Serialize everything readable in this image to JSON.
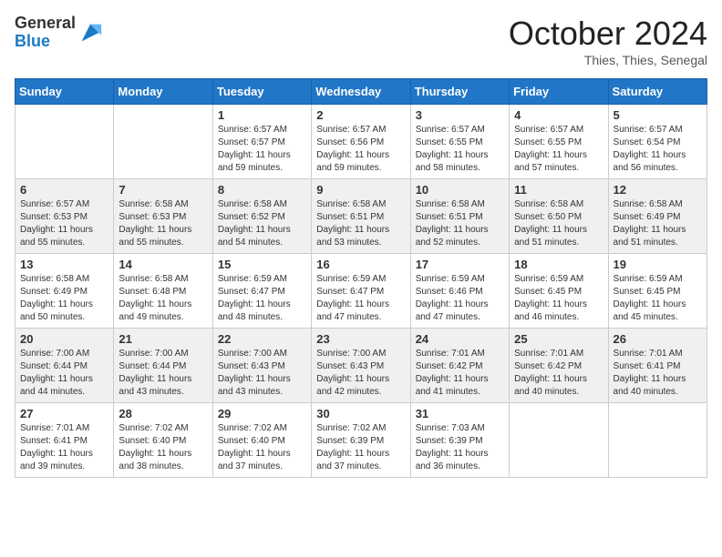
{
  "header": {
    "logo_general": "General",
    "logo_blue": "Blue",
    "month_title": "October 2024",
    "location": "Thies, Thies, Senegal"
  },
  "days_of_week": [
    "Sunday",
    "Monday",
    "Tuesday",
    "Wednesday",
    "Thursday",
    "Friday",
    "Saturday"
  ],
  "weeks": [
    [
      {
        "day": "",
        "sunrise": "",
        "sunset": "",
        "daylight": ""
      },
      {
        "day": "",
        "sunrise": "",
        "sunset": "",
        "daylight": ""
      },
      {
        "day": "1",
        "sunrise": "Sunrise: 6:57 AM",
        "sunset": "Sunset: 6:57 PM",
        "daylight": "Daylight: 11 hours and 59 minutes."
      },
      {
        "day": "2",
        "sunrise": "Sunrise: 6:57 AM",
        "sunset": "Sunset: 6:56 PM",
        "daylight": "Daylight: 11 hours and 59 minutes."
      },
      {
        "day": "3",
        "sunrise": "Sunrise: 6:57 AM",
        "sunset": "Sunset: 6:55 PM",
        "daylight": "Daylight: 11 hours and 58 minutes."
      },
      {
        "day": "4",
        "sunrise": "Sunrise: 6:57 AM",
        "sunset": "Sunset: 6:55 PM",
        "daylight": "Daylight: 11 hours and 57 minutes."
      },
      {
        "day": "5",
        "sunrise": "Sunrise: 6:57 AM",
        "sunset": "Sunset: 6:54 PM",
        "daylight": "Daylight: 11 hours and 56 minutes."
      }
    ],
    [
      {
        "day": "6",
        "sunrise": "Sunrise: 6:57 AM",
        "sunset": "Sunset: 6:53 PM",
        "daylight": "Daylight: 11 hours and 55 minutes."
      },
      {
        "day": "7",
        "sunrise": "Sunrise: 6:58 AM",
        "sunset": "Sunset: 6:53 PM",
        "daylight": "Daylight: 11 hours and 55 minutes."
      },
      {
        "day": "8",
        "sunrise": "Sunrise: 6:58 AM",
        "sunset": "Sunset: 6:52 PM",
        "daylight": "Daylight: 11 hours and 54 minutes."
      },
      {
        "day": "9",
        "sunrise": "Sunrise: 6:58 AM",
        "sunset": "Sunset: 6:51 PM",
        "daylight": "Daylight: 11 hours and 53 minutes."
      },
      {
        "day": "10",
        "sunrise": "Sunrise: 6:58 AM",
        "sunset": "Sunset: 6:51 PM",
        "daylight": "Daylight: 11 hours and 52 minutes."
      },
      {
        "day": "11",
        "sunrise": "Sunrise: 6:58 AM",
        "sunset": "Sunset: 6:50 PM",
        "daylight": "Daylight: 11 hours and 51 minutes."
      },
      {
        "day": "12",
        "sunrise": "Sunrise: 6:58 AM",
        "sunset": "Sunset: 6:49 PM",
        "daylight": "Daylight: 11 hours and 51 minutes."
      }
    ],
    [
      {
        "day": "13",
        "sunrise": "Sunrise: 6:58 AM",
        "sunset": "Sunset: 6:49 PM",
        "daylight": "Daylight: 11 hours and 50 minutes."
      },
      {
        "day": "14",
        "sunrise": "Sunrise: 6:58 AM",
        "sunset": "Sunset: 6:48 PM",
        "daylight": "Daylight: 11 hours and 49 minutes."
      },
      {
        "day": "15",
        "sunrise": "Sunrise: 6:59 AM",
        "sunset": "Sunset: 6:47 PM",
        "daylight": "Daylight: 11 hours and 48 minutes."
      },
      {
        "day": "16",
        "sunrise": "Sunrise: 6:59 AM",
        "sunset": "Sunset: 6:47 PM",
        "daylight": "Daylight: 11 hours and 47 minutes."
      },
      {
        "day": "17",
        "sunrise": "Sunrise: 6:59 AM",
        "sunset": "Sunset: 6:46 PM",
        "daylight": "Daylight: 11 hours and 47 minutes."
      },
      {
        "day": "18",
        "sunrise": "Sunrise: 6:59 AM",
        "sunset": "Sunset: 6:45 PM",
        "daylight": "Daylight: 11 hours and 46 minutes."
      },
      {
        "day": "19",
        "sunrise": "Sunrise: 6:59 AM",
        "sunset": "Sunset: 6:45 PM",
        "daylight": "Daylight: 11 hours and 45 minutes."
      }
    ],
    [
      {
        "day": "20",
        "sunrise": "Sunrise: 7:00 AM",
        "sunset": "Sunset: 6:44 PM",
        "daylight": "Daylight: 11 hours and 44 minutes."
      },
      {
        "day": "21",
        "sunrise": "Sunrise: 7:00 AM",
        "sunset": "Sunset: 6:44 PM",
        "daylight": "Daylight: 11 hours and 43 minutes."
      },
      {
        "day": "22",
        "sunrise": "Sunrise: 7:00 AM",
        "sunset": "Sunset: 6:43 PM",
        "daylight": "Daylight: 11 hours and 43 minutes."
      },
      {
        "day": "23",
        "sunrise": "Sunrise: 7:00 AM",
        "sunset": "Sunset: 6:43 PM",
        "daylight": "Daylight: 11 hours and 42 minutes."
      },
      {
        "day": "24",
        "sunrise": "Sunrise: 7:01 AM",
        "sunset": "Sunset: 6:42 PM",
        "daylight": "Daylight: 11 hours and 41 minutes."
      },
      {
        "day": "25",
        "sunrise": "Sunrise: 7:01 AM",
        "sunset": "Sunset: 6:42 PM",
        "daylight": "Daylight: 11 hours and 40 minutes."
      },
      {
        "day": "26",
        "sunrise": "Sunrise: 7:01 AM",
        "sunset": "Sunset: 6:41 PM",
        "daylight": "Daylight: 11 hours and 40 minutes."
      }
    ],
    [
      {
        "day": "27",
        "sunrise": "Sunrise: 7:01 AM",
        "sunset": "Sunset: 6:41 PM",
        "daylight": "Daylight: 11 hours and 39 minutes."
      },
      {
        "day": "28",
        "sunrise": "Sunrise: 7:02 AM",
        "sunset": "Sunset: 6:40 PM",
        "daylight": "Daylight: 11 hours and 38 minutes."
      },
      {
        "day": "29",
        "sunrise": "Sunrise: 7:02 AM",
        "sunset": "Sunset: 6:40 PM",
        "daylight": "Daylight: 11 hours and 37 minutes."
      },
      {
        "day": "30",
        "sunrise": "Sunrise: 7:02 AM",
        "sunset": "Sunset: 6:39 PM",
        "daylight": "Daylight: 11 hours and 37 minutes."
      },
      {
        "day": "31",
        "sunrise": "Sunrise: 7:03 AM",
        "sunset": "Sunset: 6:39 PM",
        "daylight": "Daylight: 11 hours and 36 minutes."
      },
      {
        "day": "",
        "sunrise": "",
        "sunset": "",
        "daylight": ""
      },
      {
        "day": "",
        "sunrise": "",
        "sunset": "",
        "daylight": ""
      }
    ]
  ]
}
